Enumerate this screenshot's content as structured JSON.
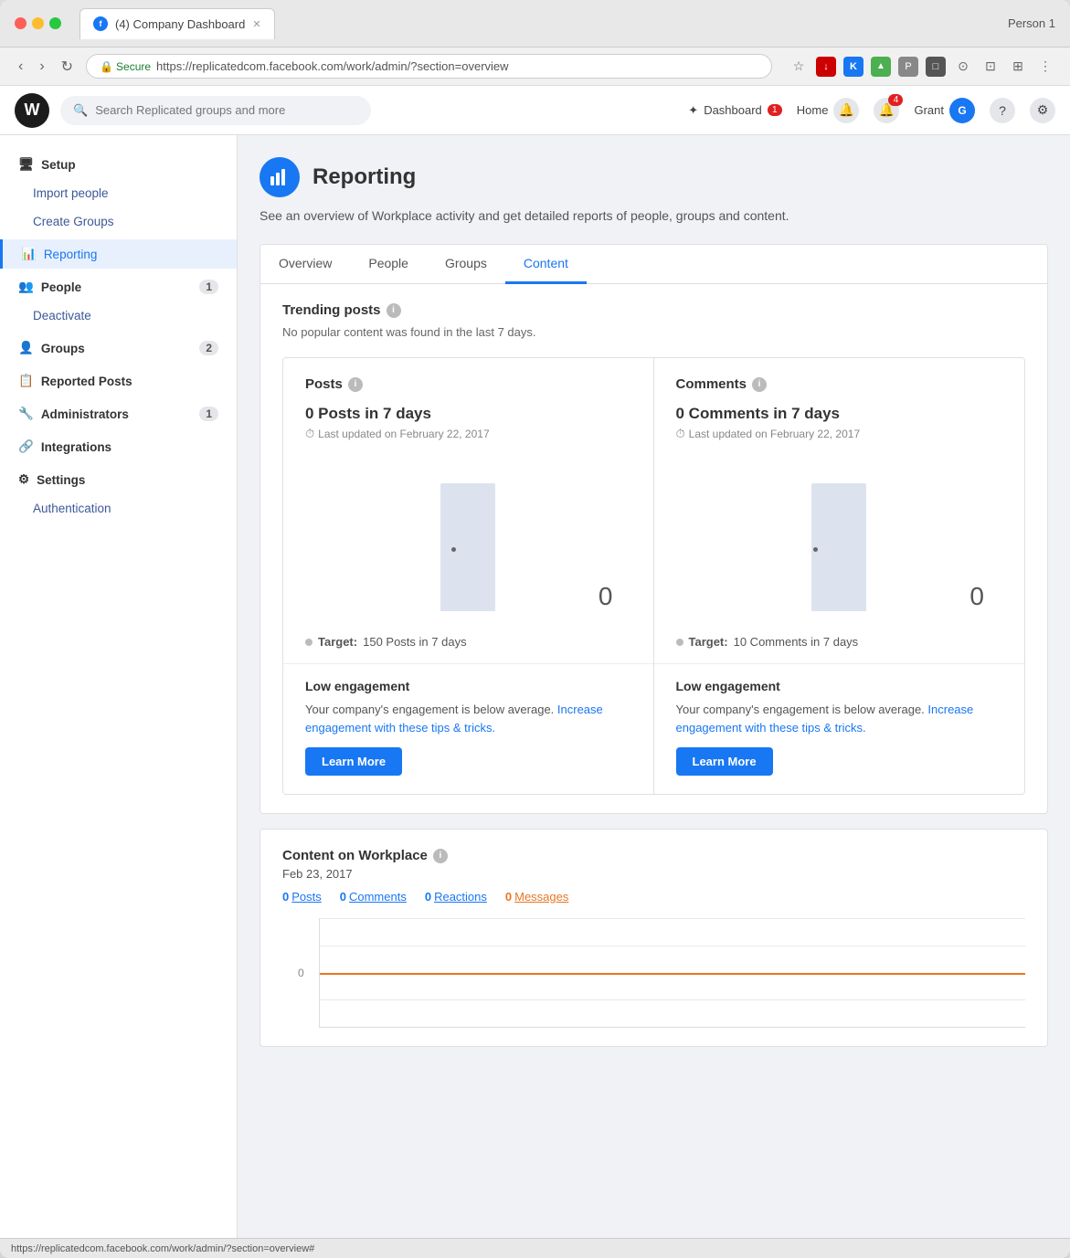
{
  "browser": {
    "tab_title": "(4) Company Dashboard",
    "url": "https://replicatedcom.facebook.com/work/admin/?section=overview",
    "person_label": "Person 1",
    "secure_text": "Secure"
  },
  "topnav": {
    "search_placeholder": "Search Replicated groups and more",
    "dashboard_label": "Dashboard",
    "dashboard_badge": "1",
    "home_label": "Home",
    "notifications_badge": "4",
    "user_label": "Grant",
    "logo_letter": "W"
  },
  "sidebar": {
    "setup_label": "Setup",
    "import_people_label": "Import people",
    "create_groups_label": "Create Groups",
    "reporting_label": "Reporting",
    "people_label": "People",
    "people_count": "1",
    "deactivate_label": "Deactivate",
    "groups_label": "Groups",
    "groups_count": "2",
    "reported_posts_label": "Reported Posts",
    "administrators_label": "Administrators",
    "administrators_count": "1",
    "integrations_label": "Integrations",
    "settings_label": "Settings",
    "authentication_label": "Authentication"
  },
  "page": {
    "title": "Reporting",
    "subtitle": "See an overview of Workplace activity and get detailed reports of people, groups and content."
  },
  "tabs": [
    {
      "label": "Overview",
      "active": false
    },
    {
      "label": "People",
      "active": false
    },
    {
      "label": "Groups",
      "active": false
    },
    {
      "label": "Content",
      "active": true
    }
  ],
  "trending": {
    "title": "Trending posts",
    "no_content": "No popular content was found in the last 7 days."
  },
  "posts_panel": {
    "title": "Posts",
    "count": "0 Posts in 7 days",
    "updated": "Last updated on February 22, 2017",
    "chart_value": "0",
    "target_label": "Target:",
    "target_value": "150 Posts in 7 days",
    "engagement_title": "Low engagement",
    "engagement_text": "Your company's engagement is below average. Increase engagement with these tips & tricks.",
    "learn_more": "Learn More"
  },
  "comments_panel": {
    "title": "Comments",
    "count": "0 Comments in 7 days",
    "updated": "Last updated on February 22, 2017",
    "chart_value": "0",
    "target_label": "Target:",
    "target_value": "10 Comments in 7 days",
    "engagement_title": "Low engagement",
    "engagement_text": "Your company's engagement is below average. Increase engagement with these tips & tricks.",
    "learn_more": "Learn More"
  },
  "workplace_content": {
    "title": "Content on Workplace",
    "date": "Feb 23, 2017",
    "metrics": [
      {
        "num": "0",
        "label": "Posts",
        "type": "posts"
      },
      {
        "num": "0",
        "label": "Comments",
        "type": "comments"
      },
      {
        "num": "0",
        "label": "Reactions",
        "type": "reactions"
      },
      {
        "num": "0",
        "label": "Messages",
        "type": "messages"
      }
    ],
    "chart_y_label": "0"
  }
}
